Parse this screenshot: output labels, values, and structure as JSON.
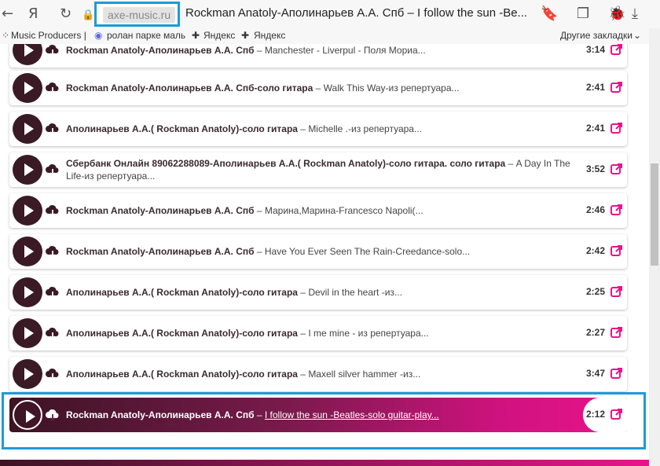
{
  "browser": {
    "url": "axe-music.ru",
    "tab_title": "Rockman Anatoly-Аполинарьев А.А. Спб – I follow the sun -Be..."
  },
  "bookmarks": {
    "items": [
      "Music Producers |",
      "ролан парке маль",
      "Яндекс",
      "Яндекс"
    ],
    "other": "Другие закладки"
  },
  "tracks": [
    {
      "artist": "Rockman Anatoly-Аполинарьев А.А. Спб",
      "title": "Manchester - Liverpul - Поля Мориа...",
      "duration": "3:14"
    },
    {
      "artist": "Rockman Anatoly-Аполинарьев А.А. Спб-соло гитара",
      "title": "Walk This Way-из репертуара...",
      "duration": "2:41"
    },
    {
      "artist": "Аполинарьев А.А.( Rockman Anatoly)-соло гитара",
      "title": "Michelle .-из репертуара...",
      "duration": "2:41"
    },
    {
      "artist": "Сбербанк Онлайн 89062288089-Аполинарьев А.А.( Rockman Anatoly)-соло гитара. соло гитара",
      "title": "A Day In The Life-из репертуара...",
      "duration": "3:52"
    },
    {
      "artist": "Rockman Anatoly-Аполинарьев А.А. Спб",
      "title": "Марина,Марина-Francesco Napoli(...",
      "duration": "2:46"
    },
    {
      "artist": "Rockman Anatoly-Аполинарьев А.А. Спб",
      "title": "Have You Ever Seen The Rain-Creedance-solo...",
      "duration": "2:42"
    },
    {
      "artist": "Аполинарьев А.А.( Rockman Anatoly)-соло гитара",
      "title": "Devil in the heart -из...",
      "duration": "2:25"
    },
    {
      "artist": "Аполинарьев А.А.( Rockman Anatoly)-соло гитара",
      "title": "I me mine - из репертуара...",
      "duration": "2:27"
    },
    {
      "artist": "Аполинарьев А.А.( Rockman Anatoly)-соло гитара",
      "title": "Maxell silver hammer -из...",
      "duration": "3:47"
    },
    {
      "artist": "Rockman Anatoly-Аполинарьев А.А. Спб",
      "title": "I follow the sun -Beatles-solo guitar-play...",
      "duration": "2:12"
    }
  ],
  "colors": {
    "accent": "#e8148a",
    "dark": "#3a1a24",
    "highlight": "#1e9ad6"
  }
}
